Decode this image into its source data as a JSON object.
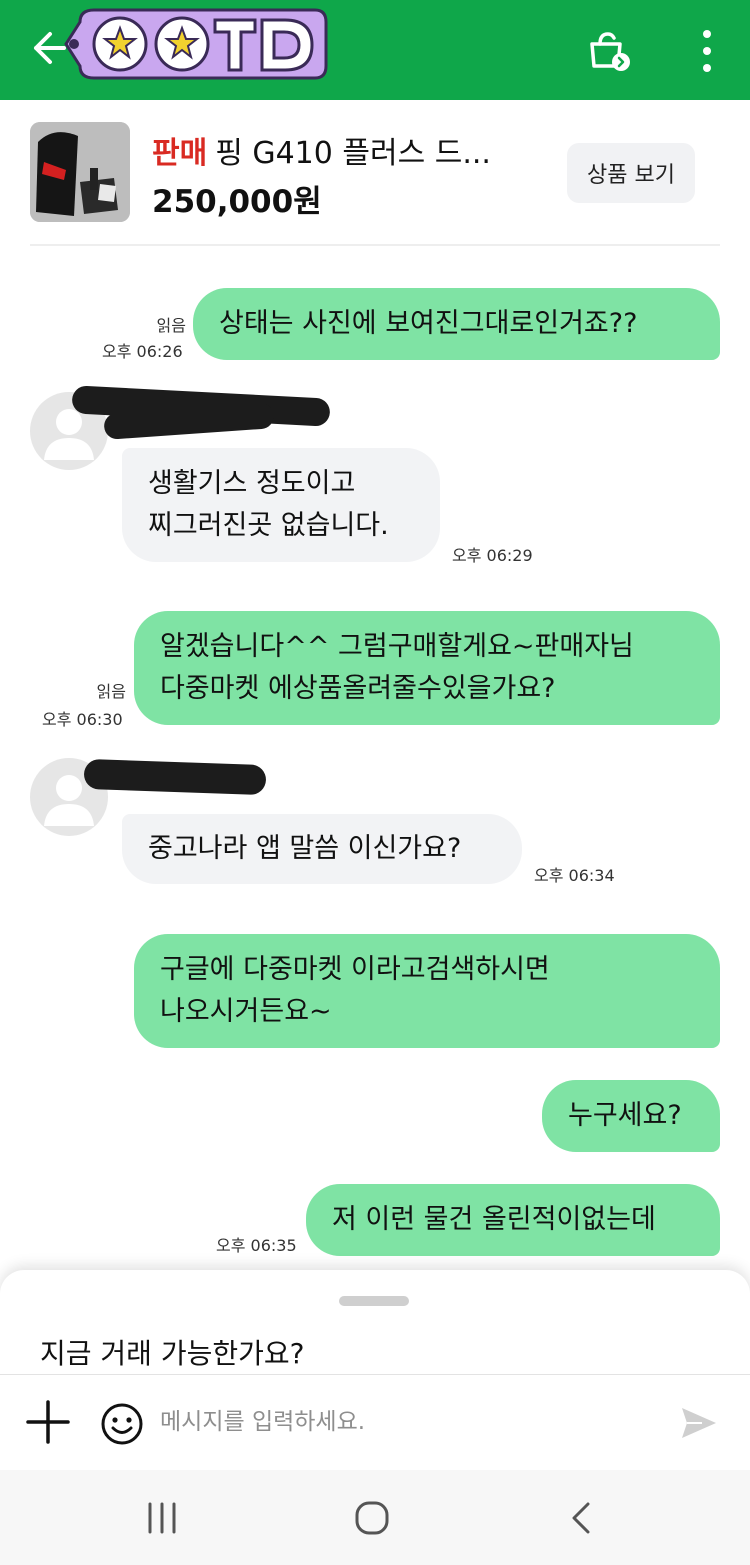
{
  "header": {
    "sticker_text": "OOTD",
    "back_icon": "arrow-left-icon",
    "shop_icon": "bag-chat-icon",
    "more_icon": "more-vertical-icon",
    "color": "#0fa74a"
  },
  "product": {
    "status": "판매",
    "title": "핑 G410 플러스 드...",
    "price": "250,000원",
    "view_button": "상품 보기"
  },
  "messages": [
    {
      "side": "out",
      "text": "상태는 사진에 보여진그대로인거죠??",
      "read": "읽음",
      "time": "오후 06:26"
    },
    {
      "side": "in",
      "lines": [
        "생활기스 정도이고",
        "찌그러진곳 없습니다."
      ],
      "time": "오후 06:29"
    },
    {
      "side": "out",
      "lines": [
        "알겠습니다^^ 그럼구매할게요~판매자님",
        "다중마켓 에상품올려줄수있을가요?"
      ],
      "read": "읽음",
      "time": "오후 06:30"
    },
    {
      "side": "in",
      "text": "중고나라 앱 말씀 이신가요?",
      "time": "오후 06:34"
    },
    {
      "side": "out",
      "lines": [
        "구글에 다중마켓 이라고검색하시면",
        "나오시거든요~"
      ]
    },
    {
      "side": "out",
      "text": "누구세요?"
    },
    {
      "side": "out",
      "text": "저 이런 물건 올린적이없는데",
      "time": "오후 06:35"
    }
  ],
  "composer": {
    "suggestion": "지금 거래 가능한가요?",
    "placeholder": "메시지를 입력하세요."
  },
  "colors": {
    "outgoing_bubble": "#7fe3a4",
    "incoming_bubble": "#f2f3f5",
    "sale_label": "#d92a22"
  }
}
